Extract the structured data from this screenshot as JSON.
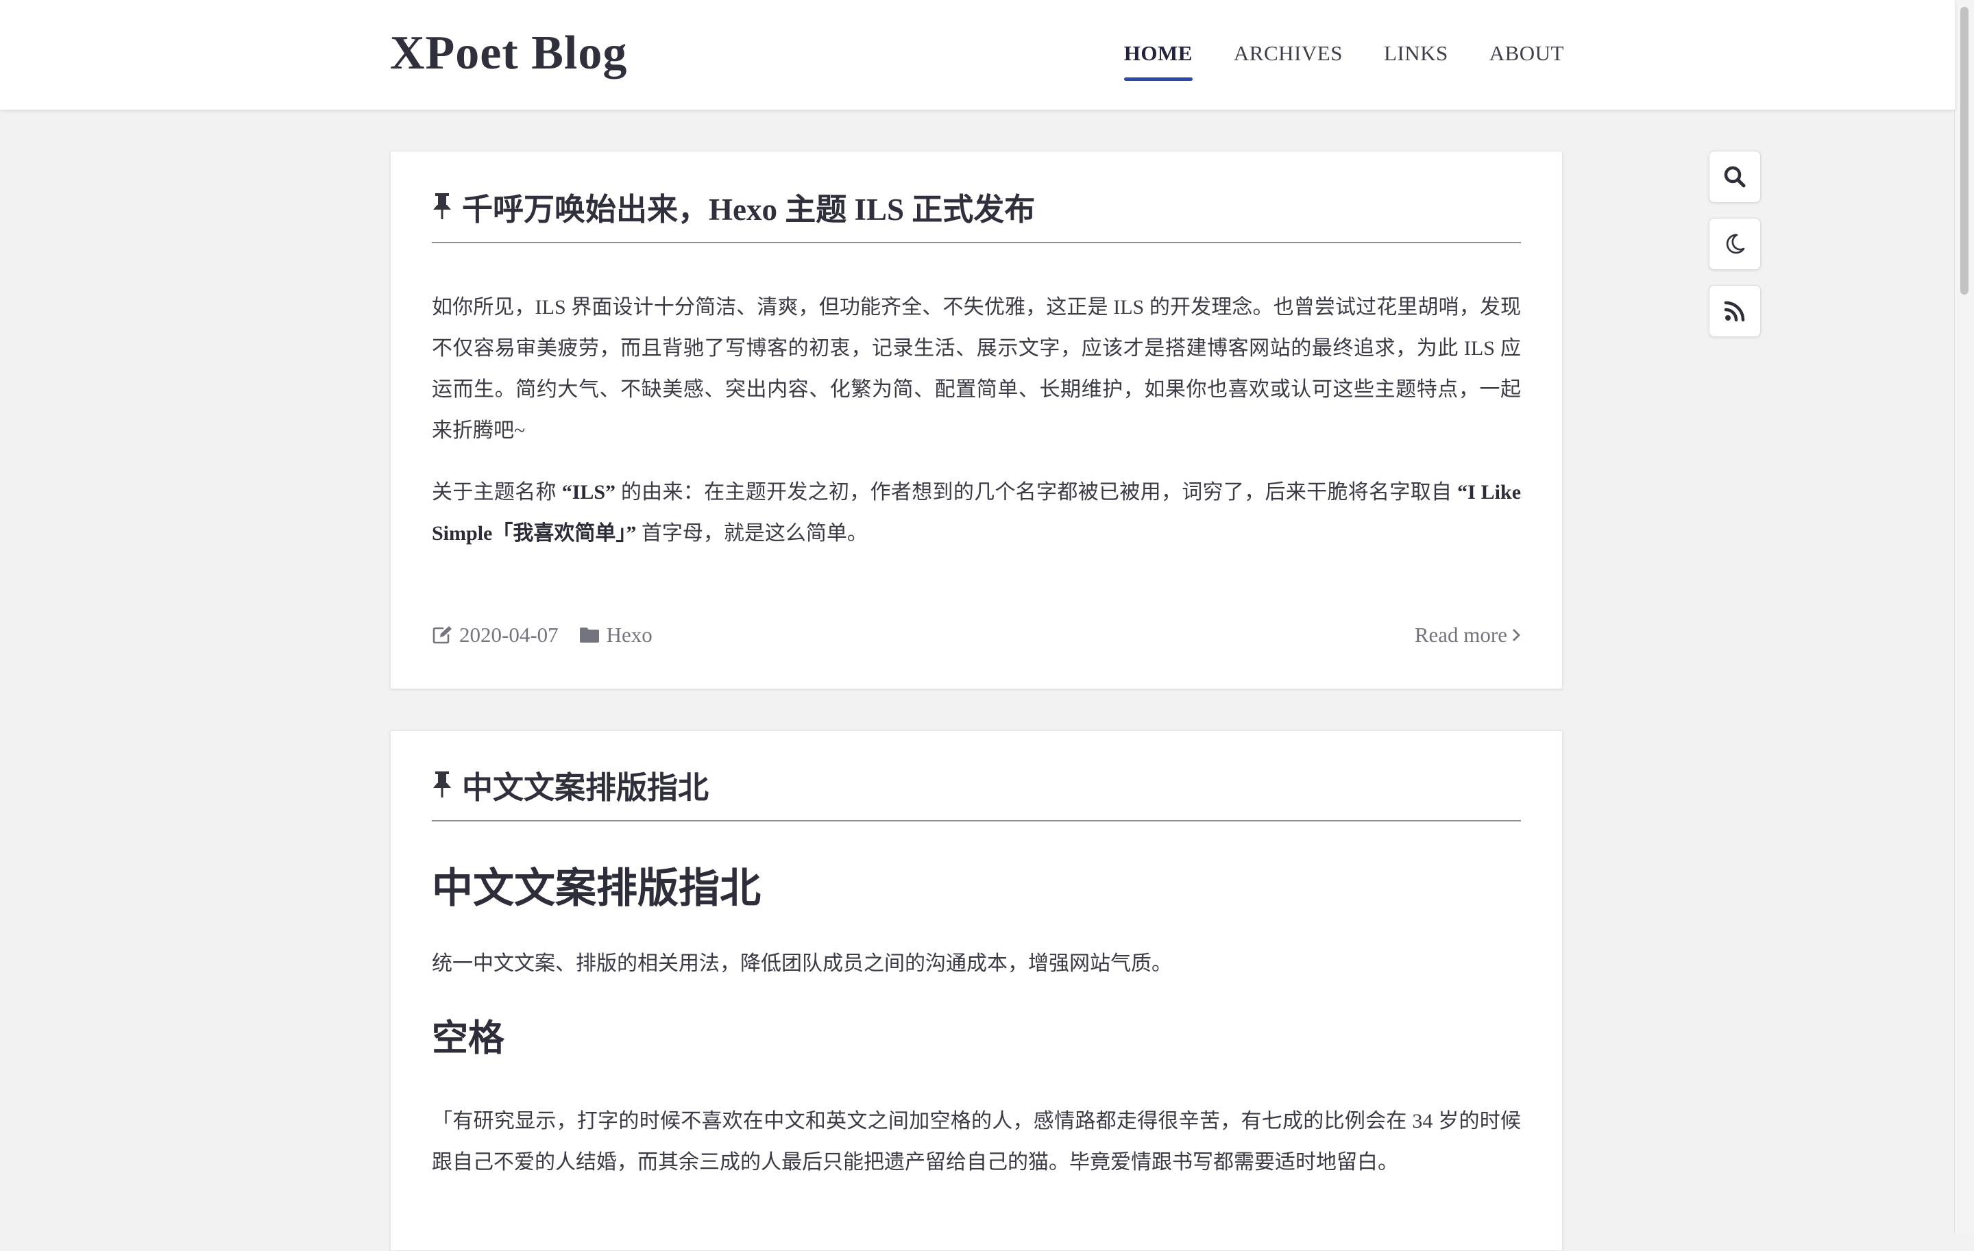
{
  "site": {
    "brand": "XPoet Blog",
    "nav": [
      "HOME",
      "ARCHIVES",
      "LINKS",
      "ABOUT"
    ],
    "active_nav": "HOME",
    "accent_color": "#2a4aa8"
  },
  "tools": {
    "search_icon": "search-icon",
    "theme_icon": "moon-icon",
    "rss_icon": "rss-icon"
  },
  "posts": [
    {
      "title": "千呼万唤始出来，Hexo 主题 ILS 正式发布",
      "pinned": true,
      "p1": "如你所见，ILS 界面设计十分简洁、清爽，但功能齐全、不失优雅，这正是 ILS 的开发理念。也曾尝试过花里胡哨，发现不仅容易审美疲劳，而且背驰了写博客的初衷，记录生活、展示文字，应该才是搭建博客网站的最终追求，为此 ILS 应运而生。简约大气、不缺美感、突出内容、化繁为简、配置简单、长期维护，如果你也喜欢或认可这些主题特点，一起来折腾吧~",
      "p2_a": "关于主题名称 ",
      "p2_b": "“ILS”",
      "p2_c": " 的由来：在主题开发之初，作者想到的几个名字都被已被用，词穷了，后来干脆将名字取自 ",
      "p2_d": "“I Like Simple「我喜欢简单」”",
      "p2_e": " 首字母，就是这么简单。",
      "date": "2020-04-07",
      "category": "Hexo",
      "read_more": "Read more"
    },
    {
      "title": "中文文案排版指北",
      "pinned": true,
      "heading": "中文文案排版指北",
      "intro": "统一中文文案、排版的相关用法，降低团队成员之间的沟通成本，增强网站气质。",
      "section": "空格",
      "quote": "「有研究显示，打字的时候不喜欢在中文和英文之间加空格的人，感情路都走得很辛苦，有七成的比例会在 34 岁的时候跟自己不爱的人结婚，而其余三成的人最后只能把遗产留给自己的猫。毕竟爱情跟书写都需要适时地留白。"
    }
  ]
}
